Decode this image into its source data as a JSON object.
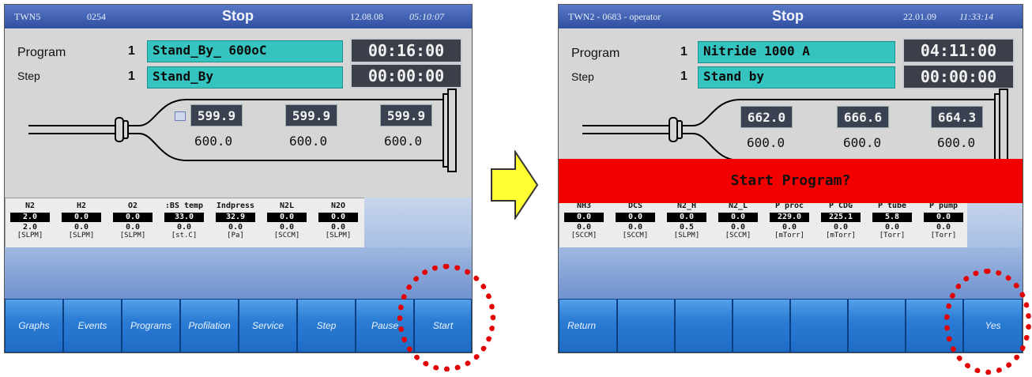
{
  "left": {
    "title_id": "TWN5",
    "title_code": "0254",
    "state": "Stop",
    "date": "12.08.08",
    "time": "05:10:07",
    "program_label": "Program",
    "program_num": "1",
    "program_name": "Stand_By_ 600oC",
    "program_time": "00:16:00",
    "step_label": "Step",
    "step_num": "1",
    "step_name": "Stand_By",
    "step_time": "00:00:00",
    "temps": [
      {
        "actual": "599.9",
        "setpoint": "600.0"
      },
      {
        "actual": "599.9",
        "setpoint": "600.0"
      },
      {
        "actual": "599.9",
        "setpoint": "600.0"
      }
    ],
    "gases": [
      {
        "name": "N2",
        "value": "2.0",
        "set": "2.0",
        "unit": "[SLPM]"
      },
      {
        "name": "H2",
        "value": "0.0",
        "set": "0.0",
        "unit": "[SLPM]"
      },
      {
        "name": "O2",
        "value": "0.0",
        "set": "0.0",
        "unit": "[SLPM]"
      },
      {
        "name": ":BS temp",
        "value": "33.0",
        "set": "0.0",
        "unit": "[st.C]"
      },
      {
        "name": "Indpress",
        "value": "32.9",
        "set": "0.0",
        "unit": "[Pa]"
      },
      {
        "name": "N2L",
        "value": "0.0",
        "set": "0.0",
        "unit": "[SCCM]"
      },
      {
        "name": "N2O",
        "value": "0.0",
        "set": "0.0",
        "unit": "[SLPM]"
      }
    ],
    "buttons": [
      "Graphs",
      "Events",
      "Programs",
      "Profilation",
      "Service",
      "Step",
      "Pause",
      "Start"
    ]
  },
  "right": {
    "title_id": "TWN2 - 0683 - operator",
    "state": "Stop",
    "date": "22.01.09",
    "time": "11:33:14",
    "program_label": "Program",
    "program_num": "1",
    "program_name": "Nitride 1000 A",
    "program_time": "04:11:00",
    "step_label": "Step",
    "step_num": "1",
    "step_name": "Stand by",
    "step_time": "00:00:00",
    "temps": [
      {
        "actual": "662.0",
        "setpoint": "600.0"
      },
      {
        "actual": "666.6",
        "setpoint": "600.0"
      },
      {
        "actual": "664.3",
        "setpoint": "600.0"
      }
    ],
    "alert": "Start Program?",
    "gases": [
      {
        "name": "NH3",
        "value": "0.0",
        "set": "0.0",
        "unit": "[SCCM]"
      },
      {
        "name": "DCS",
        "value": "0.0",
        "set": "0.0",
        "unit": "[SCCM]"
      },
      {
        "name": "N2_H",
        "value": "0.0",
        "set": "0.5",
        "unit": "[SLPM]"
      },
      {
        "name": "N2_L",
        "value": "0.0",
        "set": "0.0",
        "unit": "[SCCM]"
      },
      {
        "name": "P proc",
        "value": "229.0",
        "set": "0.0",
        "unit": "[mTorr]"
      },
      {
        "name": "P CDG",
        "value": "225.1",
        "set": "0.0",
        "unit": "[mTorr]"
      },
      {
        "name": "P tube",
        "value": "5.8",
        "set": "0.0",
        "unit": "[Torr]"
      },
      {
        "name": "P pump",
        "value": "0.0",
        "set": "0.0",
        "unit": "[Torr]"
      }
    ],
    "buttons": [
      "Return",
      "",
      "",
      "",
      "",
      "",
      "",
      "Yes"
    ]
  },
  "arrow_color": "#ffff33",
  "highlight_color": "#e30000"
}
